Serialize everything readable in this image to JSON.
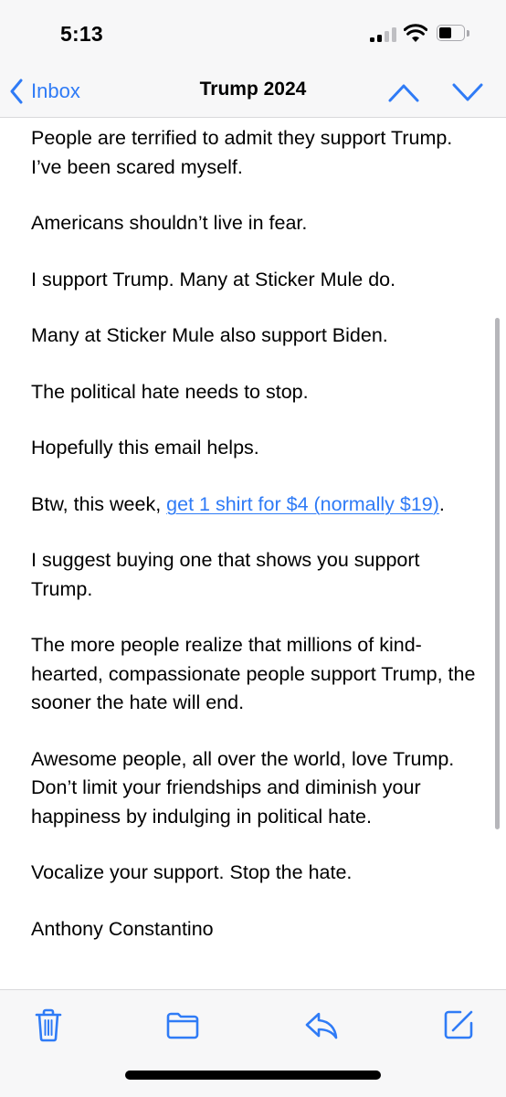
{
  "status_bar": {
    "time": "5:13",
    "signal_icon": "cellular-signal-icon",
    "wifi_icon": "wifi-icon",
    "battery_icon": "battery-icon",
    "battery_level": 0.55
  },
  "nav": {
    "back_label": "Inbox",
    "title": "Trump 2024",
    "icons": [
      "chevron-left-icon",
      "chevron-up-icon",
      "chevron-down-icon"
    ]
  },
  "email": {
    "paragraphs": [
      {
        "text": "People are terrified to admit they support Trump. I’ve been scared myself."
      },
      {
        "text": "Americans shouldn’t live in fear."
      },
      {
        "text": "I support Trump. Many at Sticker Mule do."
      },
      {
        "text": "Many at Sticker Mule also support Biden."
      },
      {
        "text": "The political hate needs to stop."
      },
      {
        "text": "Hopefully this email helps."
      },
      {
        "text_before": "Btw, this week, ",
        "link_text": "get 1 shirt for $4 (normally $19)",
        "text_after": "."
      },
      {
        "text": "I suggest buying one that shows you support Trump."
      },
      {
        "text": "The more people realize that millions of kind-hearted, compassionate people support Trump, the sooner the hate will end."
      },
      {
        "text": "Awesome people, all over the world, love Trump. Don’t limit your friendships and diminish your happiness by indulging in political hate."
      },
      {
        "text": "Vocalize your support. Stop the hate."
      },
      {
        "text": "Anthony Constantino"
      }
    ]
  },
  "toolbar": {
    "icons": [
      "trash-icon",
      "folder-icon",
      "reply-icon",
      "compose-icon"
    ]
  },
  "colors": {
    "accent": "#2f7bf6",
    "bar_background": "#f7f7f8",
    "text": "#000000"
  }
}
